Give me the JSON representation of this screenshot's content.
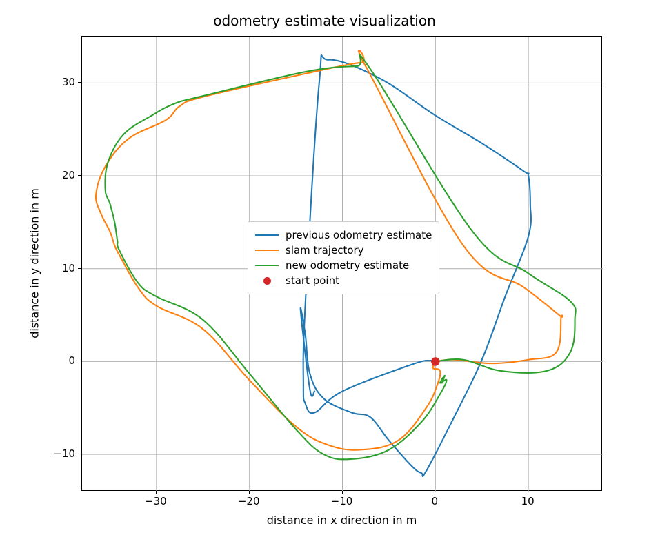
{
  "chart_data": {
    "type": "line",
    "title": "odometry estimate visualization",
    "xlabel": "distance in x direction in m",
    "ylabel": "distance in y direction in m",
    "xlim": [
      -38,
      18
    ],
    "ylim": [
      -14,
      35
    ],
    "xticks": [
      -30,
      -20,
      -10,
      0,
      10
    ],
    "yticks": [
      -10,
      0,
      10,
      20,
      30
    ],
    "legend_position": "center",
    "series": [
      {
        "name": "previous odometry estimate",
        "color": "#1f77b4",
        "x": [
          0,
          -0.5,
          -2.5,
          -10,
          -13,
          -14,
          -14.2,
          -14,
          -12.5,
          -11.5,
          -6,
          0,
          5,
          9.5,
          10,
          10.2,
          10,
          7.5,
          5,
          2,
          -1,
          -1.5,
          -2.5,
          -5,
          -7,
          -9,
          -12,
          -13.5,
          -14,
          -14.5,
          -13.5,
          -13
        ],
        "y": [
          0,
          0.1,
          -0.3,
          -3.2,
          -5.5,
          -4.5,
          -2.5,
          6,
          30,
          32.5,
          30.5,
          26.5,
          23.5,
          20.5,
          20,
          17,
          13.5,
          7,
          0.2,
          -6,
          -11.8,
          -12,
          -11.3,
          -8.5,
          -6,
          -5.5,
          -4,
          -1.3,
          3,
          5.5,
          -3,
          -3.2
        ]
      },
      {
        "name": "slam trajectory",
        "color": "#ff7f0e",
        "x": [
          0,
          2,
          6,
          10,
          13,
          13.5,
          13.3,
          9.5,
          3,
          -7.5,
          -8,
          -14,
          -25,
          -27.5,
          -29,
          -33,
          -35.5,
          -36.5,
          -36,
          -35,
          -34.5,
          -34,
          -32,
          -30,
          -25,
          -20,
          -15,
          -11.5,
          -8,
          -4,
          -1,
          0.2,
          0.5,
          -0.3,
          0,
          -0.3
        ],
        "y": [
          0,
          0.2,
          -0.2,
          0.2,
          1,
          4.7,
          5,
          8,
          12.5,
          31.8,
          32.2,
          31,
          28.5,
          27.5,
          26,
          24,
          21,
          18,
          16,
          14,
          12.5,
          11.5,
          8,
          6,
          3.5,
          -2,
          -7,
          -9,
          -9.5,
          -8.5,
          -5,
          -2.5,
          -1,
          -0.7,
          0,
          -0.7
        ]
      },
      {
        "name": "new odometry estimate",
        "color": "#2ca02c",
        "x": [
          0,
          3,
          7,
          12,
          14.5,
          15,
          14.5,
          10,
          4,
          -7,
          -8.5,
          -14,
          -25,
          -28,
          -30.5,
          -33.5,
          -35.2,
          -35.5,
          -35,
          -34.5,
          -34.2,
          -34,
          -32,
          -30,
          -25,
          -20,
          -15,
          -12,
          -9,
          -5,
          -1.5,
          0.5,
          1.2,
          0.5,
          1,
          0.7
        ],
        "y": [
          0,
          0.2,
          -1,
          -1,
          1,
          4.5,
          6.5,
          9.5,
          14,
          31.5,
          31.8,
          31.2,
          28.6,
          27.8,
          26.5,
          24.5,
          21.5,
          18.5,
          17,
          15,
          13,
          12,
          8.5,
          7,
          4.5,
          -1.3,
          -7.3,
          -10,
          -10.5,
          -9.5,
          -6.5,
          -3.5,
          -2,
          -2.3,
          -1.5,
          -2.3
        ]
      }
    ],
    "markers": [
      {
        "name": "start point",
        "color": "#d62728",
        "x": 0,
        "y": 0
      }
    ]
  },
  "legend": {
    "items": [
      {
        "label": "previous odometry estimate",
        "kind": "line",
        "colorPath": "chart_data.series.0.color"
      },
      {
        "label": "slam trajectory",
        "kind": "line",
        "colorPath": "chart_data.series.1.color"
      },
      {
        "label": "new odometry estimate",
        "kind": "line",
        "colorPath": "chart_data.series.2.color"
      },
      {
        "label": "start point",
        "kind": "dot",
        "colorPath": "chart_data.markers.0.color"
      }
    ]
  }
}
